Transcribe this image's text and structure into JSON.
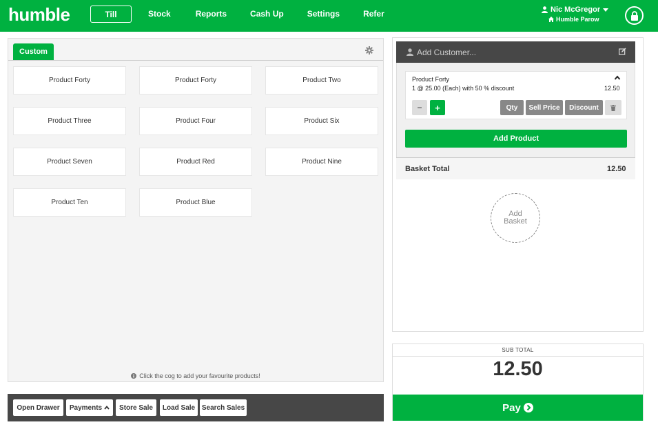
{
  "brand": {
    "logo_text": "humble",
    "accent": "#00b140"
  },
  "nav": {
    "items": [
      {
        "label": "Till",
        "active": true
      },
      {
        "label": "Stock"
      },
      {
        "label": "Reports"
      },
      {
        "label": "Cash Up"
      },
      {
        "label": "Settings"
      },
      {
        "label": "Refer"
      }
    ]
  },
  "user": {
    "name": "Nic McGregor",
    "store": "Humble Parow",
    "icons": [
      "user-icon",
      "caret-down-icon",
      "home-icon",
      "lock-icon"
    ]
  },
  "products": {
    "tab_label": "Custom",
    "items": [
      "Product Forty",
      "Product Forty",
      "Product Two",
      "Product Three",
      "Product Four",
      "Product Six",
      "Product Seven",
      "Product Red",
      "Product Nine",
      "Product Ten",
      "Product Blue"
    ],
    "hint": "Click the cog to add your favourite products!"
  },
  "actions": {
    "open_drawer": "Open Drawer",
    "payments": "Payments",
    "store_sale": "Store Sale",
    "load_sale": "Load Sale",
    "search_sales": "Search Sales"
  },
  "basket": {
    "customer_placeholder": "Add Customer...",
    "line": {
      "name": "Product Forty",
      "detail": "1 @ 25.00 (Each) with 50 % discount",
      "price": "12.50",
      "qty_label": "Qty",
      "sell_price_label": "Sell Price",
      "discount_label": "Discount",
      "minus": "−",
      "plus": "+"
    },
    "add_product_label": "Add Product",
    "total_label": "Basket Total",
    "total_value": "12.50",
    "add_basket_line1": "Add",
    "add_basket_line2": "Basket"
  },
  "subtotal": {
    "label": "SUB TOTAL",
    "value": "12.50",
    "pay_label": "Pay"
  }
}
